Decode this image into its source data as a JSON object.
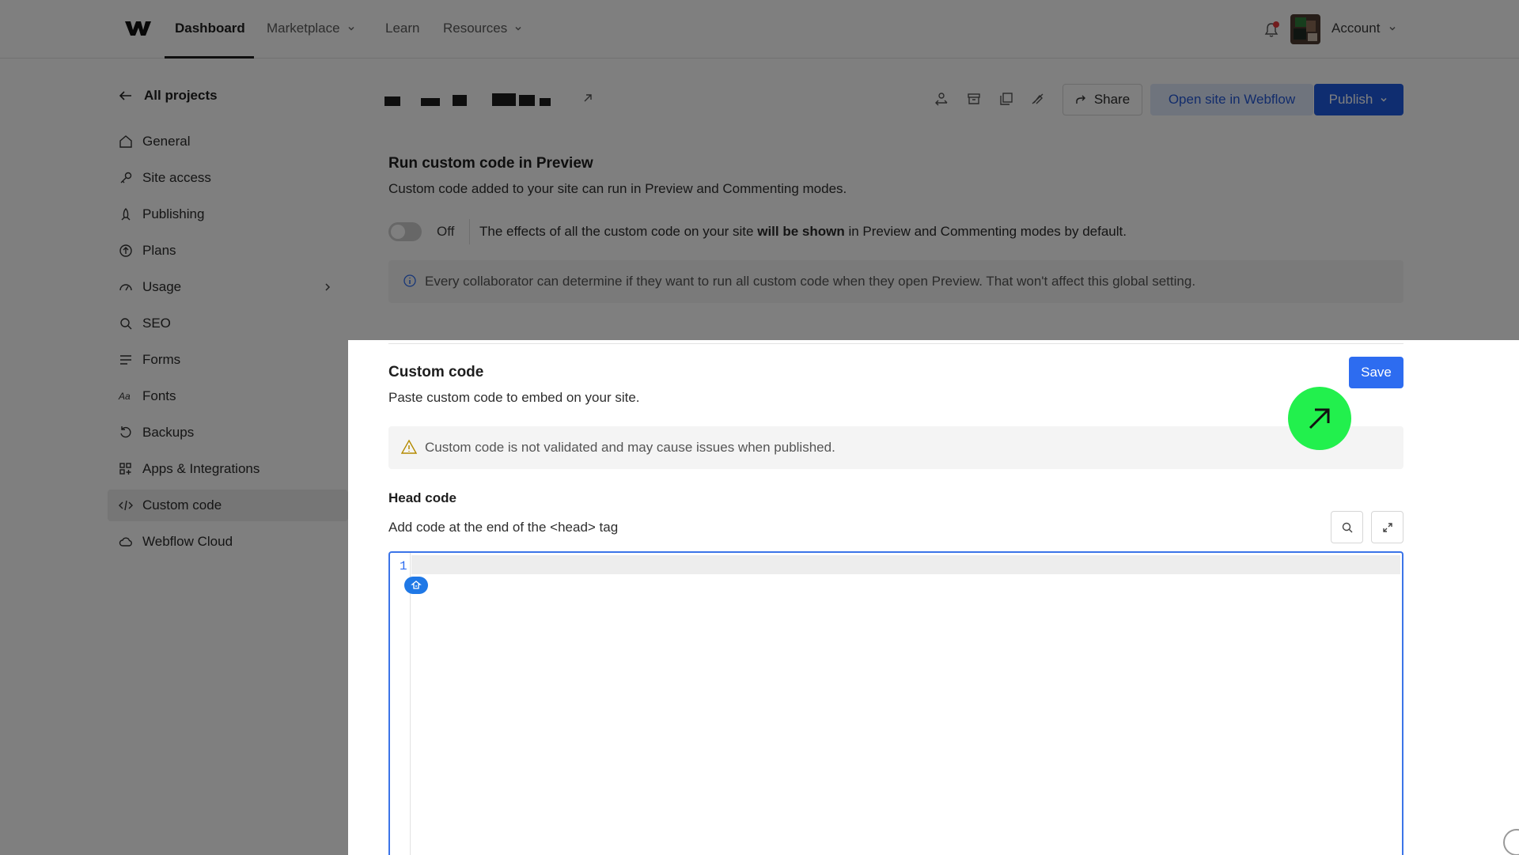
{
  "nav": {
    "items": [
      {
        "label": "Dashboard",
        "active": true,
        "dropdown": false
      },
      {
        "label": "Marketplace",
        "active": false,
        "dropdown": true
      },
      {
        "label": "Learn",
        "active": false,
        "dropdown": false
      },
      {
        "label": "Resources",
        "active": false,
        "dropdown": true
      }
    ],
    "account_label": "Account",
    "logo_icon": "webflow-logo-icon",
    "notification_icon": "bell-icon"
  },
  "sidebar": {
    "back_label": "All projects",
    "items": [
      {
        "label": "General",
        "icon": "home-icon"
      },
      {
        "label": "Site access",
        "icon": "key-icon"
      },
      {
        "label": "Publishing",
        "icon": "rocket-icon"
      },
      {
        "label": "Plans",
        "icon": "plan-icon"
      },
      {
        "label": "Usage",
        "icon": "gauge-icon",
        "has_submenu": true
      },
      {
        "label": "SEO",
        "icon": "search-icon"
      },
      {
        "label": "Forms",
        "icon": "form-lines-icon"
      },
      {
        "label": "Fonts",
        "icon": "font-icon",
        "glyph": "Aa"
      },
      {
        "label": "Backups",
        "icon": "restore-icon"
      },
      {
        "label": "Apps & Integrations",
        "icon": "apps-icon"
      },
      {
        "label": "Custom code",
        "icon": "code-icon",
        "active": true
      },
      {
        "label": "Webflow Cloud",
        "icon": "cloud-icon"
      }
    ]
  },
  "header": {
    "share_label": "Share",
    "open_label": "Open site in Webflow",
    "publish_label": "Publish",
    "toolbar_icons": [
      "transfer-icon",
      "archive-icon",
      "duplicate-icon",
      "hide-icon"
    ]
  },
  "preview": {
    "title": "Run custom code in Preview",
    "description": "Custom code added to your site can run in Preview and Commenting modes.",
    "toggle_state": "Off",
    "toggle_desc_before": "The effects of all the custom code on your site ",
    "toggle_desc_bold": "will be shown",
    "toggle_desc_after": " in Preview and Commenting modes by default.",
    "info": "Every collaborator can determine if they want to run all custom code when they open Preview. That won't affect this global setting."
  },
  "custom_code": {
    "title": "Custom code",
    "description": "Paste custom code to embed on your site.",
    "save_label": "Save",
    "warning": "Custom code is not validated and may cause issues when published.",
    "head_title": "Head code",
    "head_desc": "Add code at the end of the <head> tag",
    "line_number": "1",
    "toggle_off": false
  },
  "colors": {
    "accent": "#1f5ae0",
    "save": "#2d6cf0",
    "cursor": "#22f04d"
  }
}
